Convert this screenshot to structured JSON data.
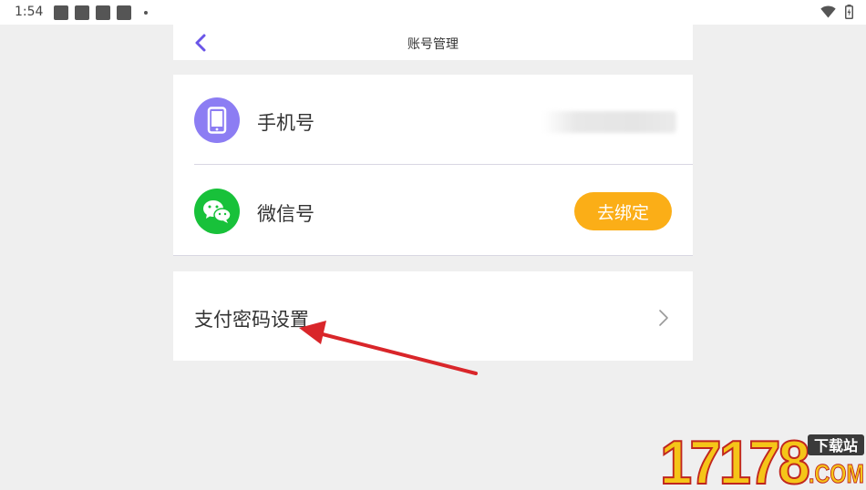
{
  "status_bar": {
    "time": "1:54",
    "icons": [
      "notification-square-icon",
      "notification-square-icon",
      "notification-square-icon",
      "notification-square-icon",
      "dot-icon",
      "wifi-icon",
      "battery-charging-icon"
    ]
  },
  "header": {
    "title": "账号管理",
    "back_icon": "chevron-left-icon"
  },
  "accounts": [
    {
      "label": "手机号",
      "icon": "smartphone-icon",
      "icon_color": "#8c7df3",
      "value_hidden": true
    },
    {
      "label": "微信号",
      "icon": "wechat-icon",
      "icon_color": "#18c13a",
      "button_label": "去绑定",
      "button_color": "#fbae17"
    }
  ],
  "payment": {
    "label": "支付密码设置",
    "icon": "chevron-right-icon"
  },
  "annotation": {
    "type": "red-arrow",
    "color": "#d9262a"
  },
  "watermark": {
    "number": "17178",
    "badge": "下载站",
    "domain": ".COM"
  },
  "colors": {
    "accent": "#6a55e8",
    "background": "#efefef",
    "card": "#ffffff"
  }
}
